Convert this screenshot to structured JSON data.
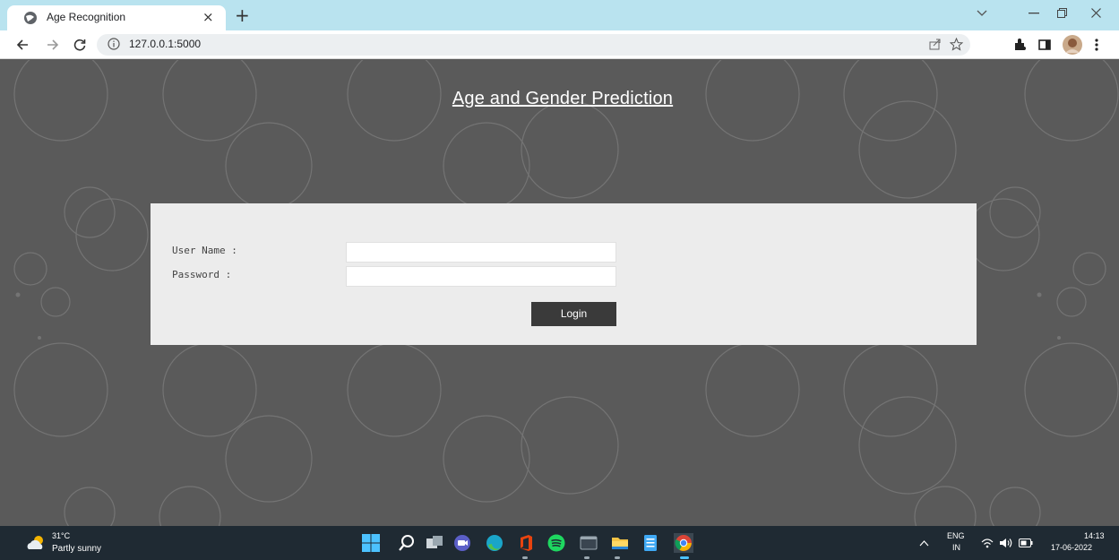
{
  "browser": {
    "tab_title": "Age Recognition",
    "tab_close": "×",
    "new_tab": "+",
    "url": "127.0.0.1:5000"
  },
  "page": {
    "heading": "Age and Gender Prediction",
    "username_label": "User Name :",
    "password_label": "Password :",
    "username_value": "",
    "password_value": "",
    "login_label": "Login"
  },
  "taskbar": {
    "temperature": "31°C",
    "condition": "Partly sunny",
    "lang_top": "ENG",
    "lang_bottom": "IN",
    "time": "14:13",
    "date": "17-06-2022"
  },
  "colors": {
    "tabstrip": "#b9e3ef",
    "page_bg": "#5a5a5a",
    "panel_bg": "#ececec",
    "button_bg": "#3a3a3a",
    "taskbar_bg": "#1f2a33"
  },
  "icons": [
    "globe-icon",
    "close-icon",
    "plus-icon",
    "chevron-down-icon",
    "minimize-icon",
    "restore-icon",
    "back-icon",
    "forward-icon",
    "reload-icon",
    "info-icon",
    "share-icon",
    "star-icon",
    "extensions-icon",
    "sidepanel-icon",
    "profile-avatar-icon",
    "menu-icon",
    "weather-icon",
    "windows-start-icon",
    "search-icon",
    "taskview-icon",
    "teams-icon",
    "edge-icon",
    "office-icon",
    "spotify-icon",
    "terminal-icon",
    "file-explorer-icon",
    "notepad-icon",
    "chrome-icon",
    "tray-chevron-icon",
    "wifi-icon",
    "volume-icon",
    "battery-icon"
  ]
}
